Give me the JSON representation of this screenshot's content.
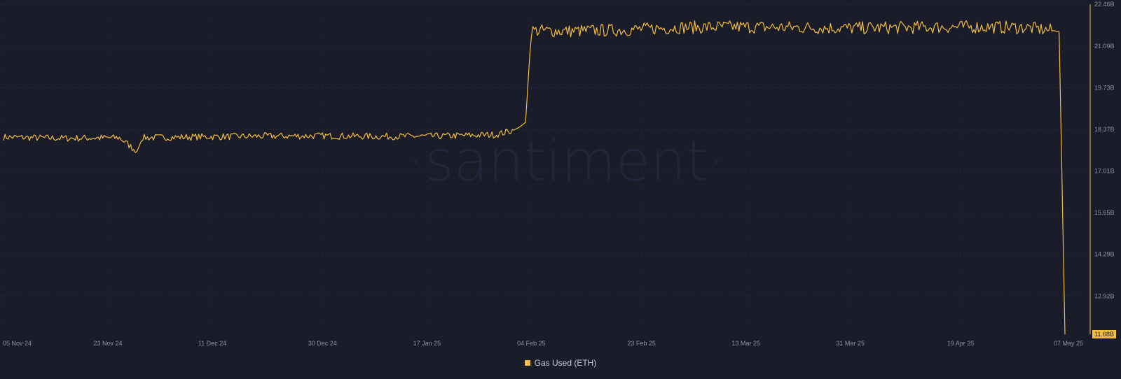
{
  "brand": {
    "watermark": "·santiment·"
  },
  "colors": {
    "background": "#1a1c2a",
    "series": "#f5bf3c",
    "grid": "#262a3b",
    "axis_line": "#f5bf3c"
  },
  "chart_data": {
    "type": "line",
    "title": "",
    "xlabel": "",
    "ylabel": "",
    "grid": true,
    "legend_position": "bottom-center",
    "x_range": [
      "2024-11-05",
      "2025-05-07"
    ],
    "x_ticks": [
      "05 Nov 24",
      "23 Nov 24",
      "11 Dec 24",
      "30 Dec 24",
      "17 Jan 25",
      "04 Feb 25",
      "23 Feb 25",
      "13 Mar 25",
      "31 Mar 25",
      "19 Apr 25",
      "07 May 25"
    ],
    "y_ticks": [
      "22.46B",
      "21.09B",
      "19.73B",
      "18.37B",
      "17.01B",
      "15.65B",
      "14.29B",
      "12.92B"
    ],
    "ylim": [
      11.68,
      22.46
    ],
    "y_unit": "B",
    "latest_label": "11.68B",
    "series": [
      {
        "name": "Gas Used (ETH)",
        "color": "#f5bf3c",
        "points": [
          [
            "2024-11-05",
            18.12
          ],
          [
            "2024-11-15",
            18.08
          ],
          [
            "2024-11-25",
            18.1
          ],
          [
            "2024-11-28",
            17.65
          ],
          [
            "2024-11-29",
            18.1
          ],
          [
            "2024-12-10",
            18.13
          ],
          [
            "2024-12-20",
            18.15
          ],
          [
            "2024-12-30",
            18.16
          ],
          [
            "2025-01-09",
            18.14
          ],
          [
            "2025-01-19",
            18.15
          ],
          [
            "2025-01-29",
            18.2
          ],
          [
            "2025-02-01",
            18.35
          ],
          [
            "2025-02-02",
            18.45
          ],
          [
            "2025-02-03",
            18.6
          ],
          [
            "2025-02-04",
            21.6
          ],
          [
            "2025-02-10",
            21.58
          ],
          [
            "2025-02-20",
            21.62
          ],
          [
            "2025-03-01",
            21.7
          ],
          [
            "2025-03-11",
            21.72
          ],
          [
            "2025-03-21",
            21.7
          ],
          [
            "2025-03-31",
            21.68
          ],
          [
            "2025-04-10",
            21.7
          ],
          [
            "2025-04-20",
            21.72
          ],
          [
            "2025-04-30",
            21.7
          ],
          [
            "2025-05-05",
            21.6
          ],
          [
            "2025-05-06",
            21.55
          ],
          [
            "2025-05-07",
            11.68
          ]
        ]
      }
    ]
  }
}
